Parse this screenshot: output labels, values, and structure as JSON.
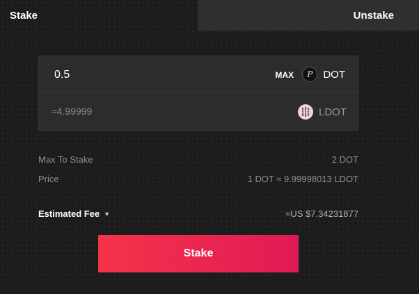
{
  "tabs": {
    "stake": "Stake",
    "unstake": "Unstake"
  },
  "input": {
    "amount": "0.5",
    "max_label": "MAX",
    "from_token": "DOT",
    "from_token_icon": "polkadot-icon",
    "estimate": "≈4.99999",
    "to_token": "LDOT",
    "to_token_icon": "ldot-icon"
  },
  "info": {
    "max_to_stake_label": "Max To Stake",
    "max_to_stake_value": "2 DOT",
    "price_label": "Price",
    "price_value": "1 DOT ≈ 9.99998013 LDOT"
  },
  "fee": {
    "label": "Estimated Fee",
    "value": "≈US $7.34231877"
  },
  "action": {
    "stake_label": "Stake"
  }
}
